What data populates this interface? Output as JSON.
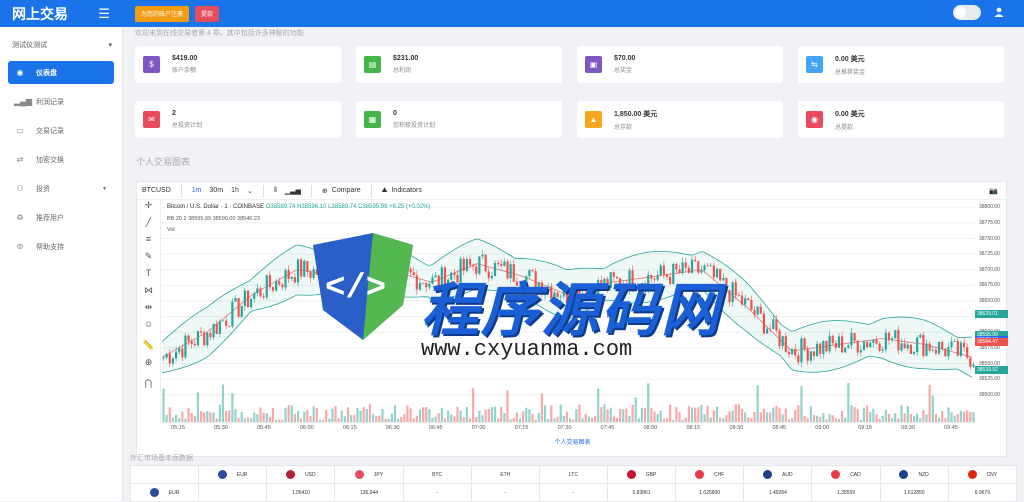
{
  "app": {
    "title": "网上交易"
  },
  "topbar": {
    "btn_register": "为您的账户注册",
    "btn_withdraw": "提款"
  },
  "sidebar": {
    "account_label": "测试仪测试",
    "items": [
      {
        "label": "仪表盘",
        "icon": "dashboard-icon",
        "active": true
      },
      {
        "label": "利润记录",
        "icon": "bar-chart-icon"
      },
      {
        "label": "交易记录",
        "icon": "briefcase-icon"
      },
      {
        "label": "加密交换",
        "icon": "exchange-icon"
      },
      {
        "label": "投资",
        "icon": "invest-icon"
      },
      {
        "label": "推荐用户",
        "icon": "referral-icon"
      },
      {
        "label": "帮助支持",
        "icon": "support-icon"
      }
    ]
  },
  "welcome": "欢迎来到在线交易者第 4 章。其中包括许多神秘的功能",
  "cards": [
    {
      "value": "$419.00",
      "label": "账户余额",
      "color": "#7e57c2",
      "icon": "dollar-icon"
    },
    {
      "value": "$231.00",
      "label": "总利润",
      "color": "#43b54a",
      "icon": "money-icon"
    },
    {
      "value": "$70.00",
      "label": "总奖金",
      "color": "#7e57c2",
      "icon": "gift-icon"
    },
    {
      "value": "0.00 美元",
      "label": "总推荐奖金",
      "color": "#42a5f5",
      "icon": "retweet-icon"
    },
    {
      "value": "2",
      "label": "总投资计划",
      "color": "#e74c5c",
      "icon": "envelope-icon"
    },
    {
      "value": "0",
      "label": "您积极投资计划",
      "color": "#43b54a",
      "icon": "wallet-icon"
    },
    {
      "value": "1,850.00 美元",
      "label": "总存款",
      "color": "#f5a623",
      "icon": "deposit-icon"
    },
    {
      "value": "0.00 美元",
      "label": "总提款",
      "color": "#e74c5c",
      "icon": "withdraw-icon"
    }
  ],
  "section_title": "个人交易图表",
  "chart_toolbar": {
    "symbol": "BTCUSD",
    "intervals": [
      "1m",
      "30m",
      "1h"
    ],
    "compare": "Compare",
    "indicators": "Indicators"
  },
  "legend": {
    "pair": "Bitcoin / U.S. Dollar · 1 · COINBASE",
    "ohlc": "O38589.74 H38596.10 L38589.74 C38595.99 +6.25 (+0.02%)",
    "bb": "BB 20 2 38595.99 38590.00 38540.23",
    "vol": "Vol"
  },
  "chart_data": {
    "type": "line",
    "title": "",
    "ylabel": "",
    "xlabel": "",
    "ylim": [
      38490,
      38810
    ],
    "yticks": [
      "38800.00",
      "38775.00",
      "38750.00",
      "38725.00",
      "38700.00",
      "38675.00",
      "38650.00",
      "38625.00",
      "38600.00",
      "38575.00",
      "38550.00",
      "38525.00",
      "38500.00"
    ],
    "x": [
      "05:15",
      "05:30",
      "05:45",
      "06:00",
      "06:15",
      "06:30",
      "06:45",
      "07:00",
      "07:15",
      "07:30",
      "07:45",
      "08:00",
      "08:15",
      "08:30",
      "08:45",
      "09:00",
      "09:15",
      "09:30",
      "09:45"
    ],
    "series": [
      {
        "values": [
          38560,
          38600,
          38660,
          38700,
          38690,
          38700,
          38680,
          38710,
          38690,
          38660,
          38680,
          38690,
          38700,
          38640,
          38570,
          38580,
          38590,
          38580,
          38560
        ]
      }
    ],
    "price_tags": [
      {
        "value": "38629.01",
        "color": "#26a69a"
      },
      {
        "value": "38595.99",
        "color": "#26a69a"
      },
      {
        "value": "38588.13",
        "color": "#2962ff"
      },
      {
        "value": "38584.47",
        "color": "#ef5350"
      },
      {
        "value": "38539.92",
        "color": "#26a69a"
      }
    ]
  },
  "chart_caption": "个人交易图表",
  "fx_title": "外汇市场基本面数据",
  "fx": {
    "headers": [
      "",
      "EUR",
      "USD",
      "JPY",
      "BTC",
      "ETH",
      "LTC",
      "GBP",
      "CHF",
      "AUD",
      "CAD",
      "NZD",
      "CNY"
    ],
    "flag_colors": [
      "",
      "#2b4aa0",
      "#b22234",
      "#e84a5f",
      "",
      "",
      "",
      "#c8102e",
      "#e63946",
      "#1b3f8b",
      "#e63946",
      "#1b3f8b",
      "#de2910"
    ],
    "row_eur": [
      "EUR",
      "",
      "1.05410",
      "136.944",
      "-",
      "-",
      "-",
      "0.83861",
      "1.026890",
      "1.49284",
      "1.35559",
      "1.612850",
      "6.9679"
    ]
  },
  "watermark": {
    "text": "程序源码网",
    "url": "www.cxyuanma.com"
  }
}
